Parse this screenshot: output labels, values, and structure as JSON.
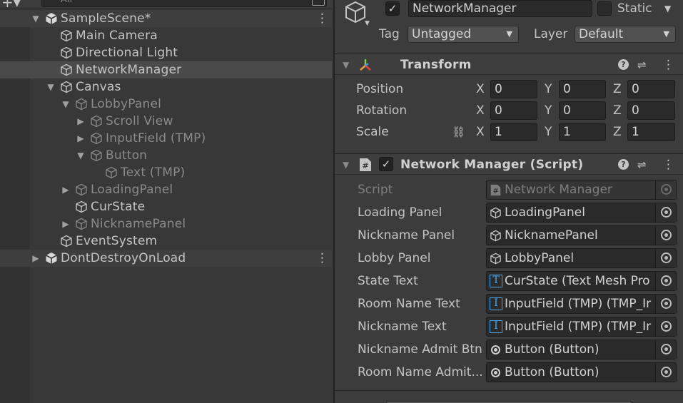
{
  "hierarchy": {
    "search_placeholder": "All",
    "items": [
      {
        "label": "SampleScene*",
        "depth": 0,
        "arrow": "▼",
        "icon": "unity-scene-icon",
        "type": "scene",
        "dim": false,
        "menu": true
      },
      {
        "label": "Main Camera",
        "depth": 1,
        "arrow": "",
        "icon": "gameobject-icon",
        "type": "go",
        "dim": false
      },
      {
        "label": "Directional Light",
        "depth": 1,
        "arrow": "",
        "icon": "gameobject-icon",
        "type": "go",
        "dim": false
      },
      {
        "label": "NetworkManager",
        "depth": 1,
        "arrow": "",
        "icon": "gameobject-icon",
        "type": "go",
        "dim": false,
        "selected": true
      },
      {
        "label": "Canvas",
        "depth": 1,
        "arrow": "▼",
        "icon": "gameobject-icon",
        "type": "go",
        "dim": false
      },
      {
        "label": "LobbyPanel",
        "depth": 2,
        "arrow": "▼",
        "icon": "gameobject-icon",
        "type": "go",
        "dim": true
      },
      {
        "label": "Scroll View",
        "depth": 3,
        "arrow": "▶",
        "icon": "gameobject-icon",
        "type": "go",
        "dim": true
      },
      {
        "label": "InputField (TMP)",
        "depth": 3,
        "arrow": "▶",
        "icon": "gameobject-icon",
        "type": "go",
        "dim": true
      },
      {
        "label": "Button",
        "depth": 3,
        "arrow": "▼",
        "icon": "gameobject-icon",
        "type": "go",
        "dim": true
      },
      {
        "label": "Text (TMP)",
        "depth": 4,
        "arrow": "",
        "icon": "gameobject-icon",
        "type": "go",
        "dim": true
      },
      {
        "label": "LoadingPanel",
        "depth": 2,
        "arrow": "▶",
        "icon": "gameobject-icon",
        "type": "go",
        "dim": true
      },
      {
        "label": "CurState",
        "depth": 2,
        "arrow": "",
        "icon": "gameobject-icon",
        "type": "go",
        "dim": false
      },
      {
        "label": "NicknamePanel",
        "depth": 2,
        "arrow": "▶",
        "icon": "gameobject-icon",
        "type": "go",
        "dim": true
      },
      {
        "label": "EventSystem",
        "depth": 1,
        "arrow": "",
        "icon": "gameobject-icon",
        "type": "go",
        "dim": false
      },
      {
        "label": "DontDestroyOnLoad",
        "depth": 0,
        "arrow": "▶",
        "icon": "unity-scene-icon",
        "type": "scene",
        "dim": false,
        "menu": true
      }
    ]
  },
  "inspector": {
    "object_name": "NetworkManager",
    "active": true,
    "static_label": "Static",
    "static_checked": false,
    "tag_label": "Tag",
    "tag_value": "Untagged",
    "layer_label": "Layer",
    "layer_value": "Default",
    "transform": {
      "title": "Transform",
      "rows": [
        {
          "label": "Position",
          "x": "0",
          "y": "0",
          "z": "0"
        },
        {
          "label": "Rotation",
          "x": "0",
          "y": "0",
          "z": "0"
        },
        {
          "label": "Scale",
          "x": "1",
          "y": "1",
          "z": "1"
        }
      ],
      "axis_x": "X",
      "axis_y": "Y",
      "axis_z": "Z"
    },
    "script_component": {
      "title": "Network Manager (Script)",
      "enabled": true,
      "fields": [
        {
          "label": "Script",
          "value": "Network Manager",
          "icon": "script-icon",
          "dim": true
        },
        {
          "label": "Loading Panel",
          "value": "LoadingPanel",
          "icon": "gameobject-icon",
          "dim": false
        },
        {
          "label": "Nickname Panel",
          "value": "NicknamePanel",
          "icon": "gameobject-icon",
          "dim": false
        },
        {
          "label": "Lobby Panel",
          "value": "LobbyPanel",
          "icon": "gameobject-icon",
          "dim": false
        },
        {
          "label": "State Text",
          "value": "CurState (Text Mesh Pro",
          "icon": "textmeshpro-icon",
          "dim": false
        },
        {
          "label": "Room Name Text",
          "value": "InputField (TMP) (TMP_Ir",
          "icon": "inputfield-icon",
          "dim": false
        },
        {
          "label": "Nickname Text",
          "value": "InputField (TMP) (TMP_Ir",
          "icon": "inputfield-icon",
          "dim": false
        },
        {
          "label": "Nickname Admit Btn",
          "value": "Button (Button)",
          "icon": "button-icon",
          "dim": false
        },
        {
          "label": "Room Name Admit...",
          "value": "Button (Button)",
          "icon": "button-icon",
          "dim": false
        }
      ]
    }
  }
}
